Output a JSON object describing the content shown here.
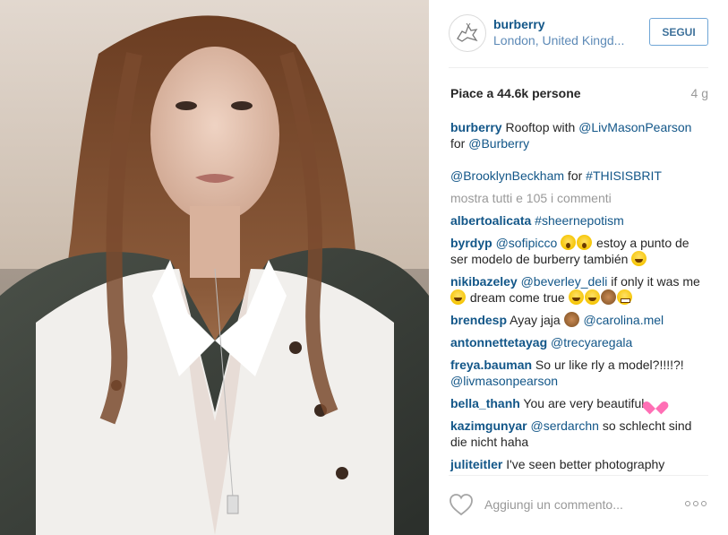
{
  "post": {
    "username": "burberry",
    "location": "London, United Kingd...",
    "follow_label": "SEGUI",
    "likes": "Piace a 44.6k persone",
    "age": "4 g"
  },
  "caption": {
    "user": "burberry",
    "text1": " Rooftop with ",
    "mention1": "@LivMasonPearson",
    "text2": " for ",
    "mention2": "@Burberry",
    "line2_mention": "@BrooklynBeckham",
    "line2_text": " for ",
    "line2_hashtag": "#THISISBRIT"
  },
  "view_all_label": "mostra tutti e 105 i commenti",
  "comments": [
    {
      "user": "albertoalicata",
      "mention": "#sheernepotism"
    },
    {
      "user": "byrdyp",
      "mention": "@sofipicco",
      "text": " estoy a punto de ser modelo de burberry también "
    },
    {
      "user": "nikibazeley",
      "mention": "@beverley_deli",
      "text": " if only it was me ",
      "text2": " dream come true "
    },
    {
      "user": "brendesp",
      "text": " Ayay jaja ",
      "mention": "@carolina.mel"
    },
    {
      "user": "antonnettetayag",
      "mention": "@trecyaregala"
    },
    {
      "user": "freya.bauman",
      "text": " So ur like rly a model?!!!!?! ",
      "mention": "@livmasonpearson"
    },
    {
      "user": "bella_thanh",
      "text": " You are very beautiful "
    },
    {
      "user": "kazimgunyar",
      "mention": "@serdarchn",
      "text": " so schlecht sind die nicht haha"
    },
    {
      "user": "juliteitler",
      "text": " I've seen better photography"
    }
  ],
  "footer": {
    "comment_placeholder": "Aggiungi un commento..."
  },
  "colors": {
    "username_blue": "#125688",
    "location_blue": "#5d8ab7",
    "follow_border": "#70a6d6",
    "muted": "#999999"
  }
}
